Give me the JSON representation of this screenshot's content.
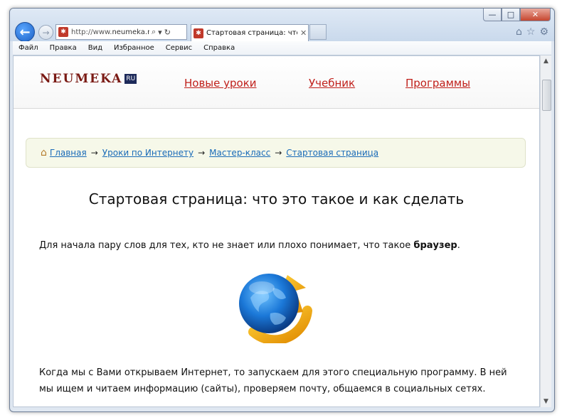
{
  "browser": {
    "url_prefix": "http://www.",
    "url_domain": "neumeka.ru/s",
    "tab_title": "Стартовая страница: что э...",
    "window_controls": {
      "minimize": "—",
      "maximize": "□",
      "close": "✕"
    }
  },
  "menu": [
    "Файл",
    "Правка",
    "Вид",
    "Избранное",
    "Сервис",
    "Справка"
  ],
  "site": {
    "logo_text": "Neumeka",
    "logo_badge": "RU",
    "nav": [
      "Новые уроки",
      "Учебник",
      "Программы"
    ],
    "accent_color": "#c0201b"
  },
  "breadcrumbs": [
    "Главная",
    "Уроки по Интернету",
    "Мастер-класс",
    "Стартовая страница"
  ],
  "breadcrumb_separator": "→",
  "article": {
    "title": "Стартовая страница: что это такое и как сделать",
    "p1_text": "Для начала пару слов для тех, кто не знает или плохо понимает, что такое",
    "p1_bold": "браузер",
    "p1_end": ".",
    "p2": "Когда мы с Вами открываем Интернет, то запускаем для этого специальную программу. В ней мы ищем и читаем информацию (сайты), проверяем почту, общаемся в социальных сетях."
  },
  "icons": {
    "back": "back-arrow-icon",
    "forward": "forward-arrow-icon",
    "search": "search-icon",
    "refresh": "refresh-icon",
    "home": "home-icon",
    "favorites": "star-icon",
    "tools": "gear-icon",
    "article_image": "internet-explorer-logo"
  }
}
